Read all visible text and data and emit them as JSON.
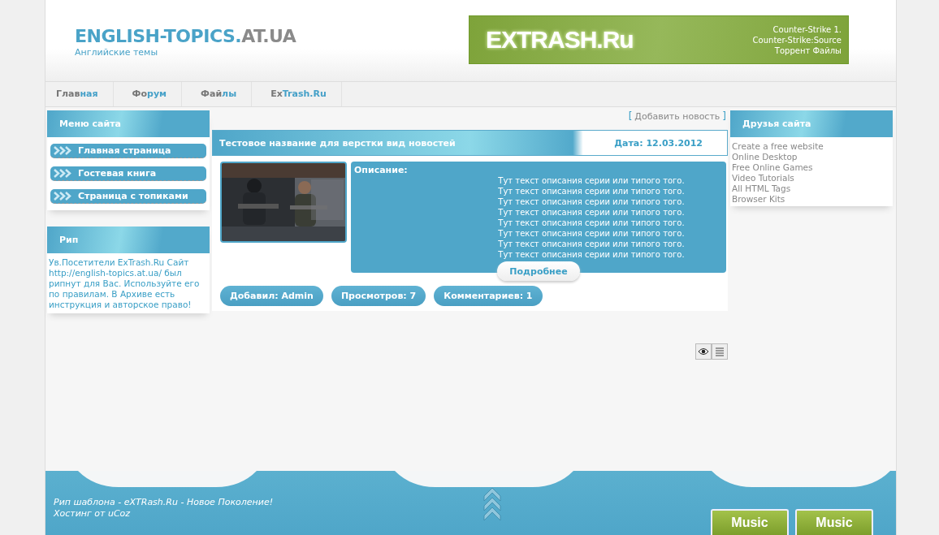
{
  "header": {
    "logo_main": "ENGLISH-TOPICS.",
    "logo_domain": "AT.UA",
    "tagline": "Английские темы",
    "banner": {
      "logo": "EXTRASH.Ru",
      "lines": [
        "Counter-Strike 1.",
        "Counter-Strike:Source",
        "Торрент Файлы"
      ]
    }
  },
  "nav": [
    {
      "parts": [
        "Глав",
        "ная"
      ]
    },
    {
      "parts": [
        "Фо",
        "рум"
      ]
    },
    {
      "parts": [
        "Фай",
        "лы"
      ]
    },
    {
      "parts": [
        "Ex",
        "Trash.Ru"
      ]
    }
  ],
  "left_blocks": [
    {
      "kind": "menu",
      "title": "Меню сайта",
      "items": [
        "Главная страница",
        "Гостевая книга",
        "Страница с топиками"
      ]
    },
    {
      "kind": "text",
      "title": "Рип",
      "text": "Ув.Посетители ExTrash.Ru Сайт http://english-topics.at.ua/ был рипнут для Вас. Используйте его по правилам. В Архиве есть инструкция и авторское право!"
    }
  ],
  "add_news": {
    "open": "[",
    "label": "Добавить новость",
    "close": "]"
  },
  "news": {
    "title": "Тестовое название для верстки вид новостей",
    "date": "Дата: 12.03.2012",
    "image": {
      "kind": "picture"
    },
    "desc_label": "Описание:",
    "lines": [
      "Тут текст описания серии или типого того.",
      "Тут текст описания серии или типого того.",
      "Тут текст описания серии или типого того.",
      "Тут текст описания серии или типого того.",
      "Тут текст описания серии или типого того.",
      "Тут текст описания серии или типого того.",
      "Тут текст описания серии или типого того.",
      "Тут текст описания серии или типого того."
    ],
    "more": "Подробнее",
    "meta": [
      "Добавил: Admin",
      "Просмотров: 7",
      "Комментариев: 1"
    ]
  },
  "friends": {
    "title": "Друзья сайта",
    "links": [
      "Create a free website",
      "Online Desktop",
      "Free Online Games",
      "Video Tutorials",
      "All HTML Tags",
      "Browser Kits"
    ]
  },
  "footer": {
    "lines": [
      "Рип шаблона - eXTRash.Ru - Новое Поколение!",
      "Хостинг от uCoz"
    ],
    "badges": [
      "Music",
      "Music"
    ]
  }
}
